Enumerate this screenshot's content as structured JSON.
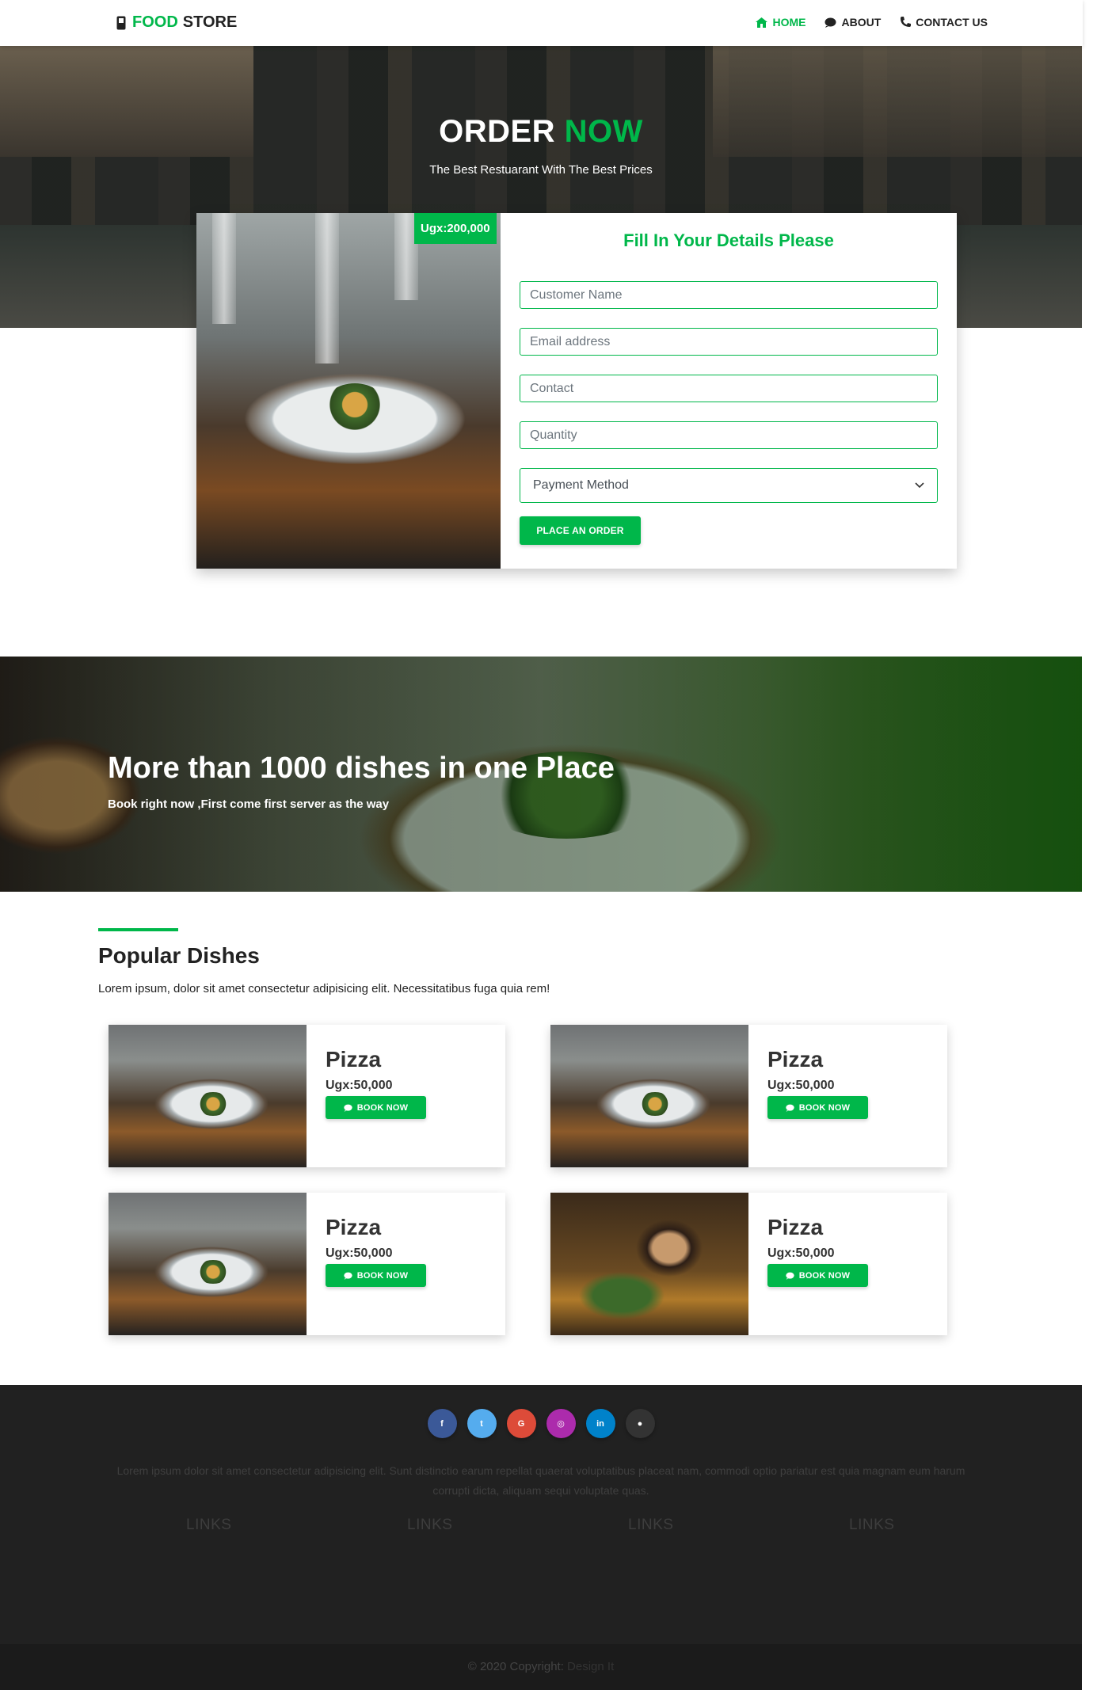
{
  "nav": {
    "brand_first": "FOOD",
    "brand_second": "STORE",
    "links": [
      {
        "label": "HOME",
        "icon": "home-icon",
        "active": true
      },
      {
        "label": "ABOUT",
        "icon": "chat-icon",
        "active": false
      },
      {
        "label": "CONTACT US",
        "icon": "phone-icon",
        "active": false
      }
    ]
  },
  "hero": {
    "title_first": "ORDER",
    "title_second": "NOW",
    "subtitle": "The Best Restuarant With The Best Prices"
  },
  "order": {
    "price": "Ugx:200,000",
    "heading": "Fill In Your Details Please",
    "placeholders": {
      "name": "Customer Name",
      "email": "Email address",
      "contact": "Contact",
      "quantity": "Quantity"
    },
    "payment_select": "Payment Method",
    "submit": "PLACE AN ORDER"
  },
  "banner": {
    "heading": "More than 1000 dishes in one Place",
    "subtext": "Book right now ,First come first server as the way"
  },
  "popular": {
    "heading": "Popular Dishes",
    "description": "Lorem ipsum, dolor sit amet consectetur adipisicing elit. Necessitatibus fuga quia rem!",
    "dishes": [
      {
        "name": "Pizza",
        "price": "Ugx:50,000",
        "button": "BOOK NOW"
      },
      {
        "name": "Pizza",
        "price": "Ugx:50,000",
        "button": "BOOK NOW"
      },
      {
        "name": "Pizza",
        "price": "Ugx:50,000",
        "button": "BOOK NOW"
      },
      {
        "name": "Pizza",
        "price": "Ugx:50,000",
        "button": "BOOK NOW"
      }
    ]
  },
  "footer": {
    "social": [
      {
        "icon": "facebook-icon",
        "glyph": "f",
        "color": "#3b5998"
      },
      {
        "icon": "twitter-icon",
        "glyph": "t",
        "color": "#55acee"
      },
      {
        "icon": "google-icon",
        "glyph": "G",
        "color": "#dd4b39"
      },
      {
        "icon": "instagram-icon",
        "glyph": "◎",
        "color": "#ac2bac"
      },
      {
        "icon": "linkedin-icon",
        "glyph": "in",
        "color": "#0082ca"
      },
      {
        "icon": "github-icon",
        "glyph": "●",
        "color": "#333333"
      }
    ],
    "text": "Lorem ipsum dolor sit amet consectetur adipisicing elit. Sunt distinctio earum repellat quaerat voluptatibus placeat nam, commodi optio pariatur est quia magnam eum harum corrupti dicta, aliquam sequi voluptate quas.",
    "links": [
      "LINKS",
      "LINKS",
      "LINKS",
      "LINKS"
    ],
    "copyright": "© 2020 Copyright:",
    "copyright_link": "Design It"
  },
  "colors": {
    "accent": "#00b74a",
    "footer_bg": "#212121"
  }
}
